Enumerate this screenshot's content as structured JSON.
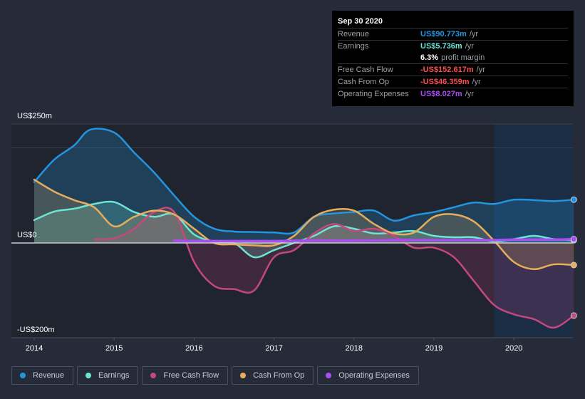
{
  "tooltip": {
    "date": "Sep 30 2020",
    "rows": [
      {
        "label": "Revenue",
        "value": "US$90.773m",
        "unit": "/yr",
        "color": "#2394df"
      },
      {
        "label": "Earnings",
        "value": "US$5.736m",
        "unit": "/yr",
        "color": "#6ce5d4"
      },
      {
        "label": "",
        "value": "6.3%",
        "unit": "profit margin",
        "color": "#ffffff"
      },
      {
        "label": "Free Cash Flow",
        "value": "-US$152.617m",
        "unit": "/yr",
        "color": "#ff4d4d"
      },
      {
        "label": "Cash From Op",
        "value": "-US$46.359m",
        "unit": "/yr",
        "color": "#ff4d4d"
      },
      {
        "label": "Operating Expenses",
        "value": "US$8.027m",
        "unit": "/yr",
        "color": "#a94ef2"
      }
    ]
  },
  "legend": [
    {
      "label": "Revenue",
      "color": "#2394df"
    },
    {
      "label": "Earnings",
      "color": "#6ce5d4"
    },
    {
      "label": "Free Cash Flow",
      "color": "#c4487f"
    },
    {
      "label": "Cash From Op",
      "color": "#e8ad5c"
    },
    {
      "label": "Operating Expenses",
      "color": "#a94ef2"
    }
  ],
  "chart_data": {
    "type": "line",
    "title": "",
    "xlabel": "",
    "ylabel": "",
    "y_tick_labels": [
      "US$250m",
      "US$0",
      "-US$200m"
    ],
    "x_tick_labels": [
      "2014",
      "2015",
      "2016",
      "2017",
      "2018",
      "2019",
      "2020"
    ],
    "xlim": [
      2014,
      2020.75
    ],
    "ylim": [
      -200,
      250
    ],
    "grid": true,
    "forecast_shade_from": 2019.75,
    "series": [
      {
        "name": "Revenue",
        "color": "#2394df",
        "x": [
          2014.0,
          2014.25,
          2014.5,
          2014.7,
          2015.0,
          2015.25,
          2015.5,
          2015.75,
          2016.0,
          2016.25,
          2016.5,
          2016.75,
          2017.0,
          2017.25,
          2017.5,
          2017.75,
          2018.0,
          2018.25,
          2018.5,
          2018.75,
          2019.0,
          2019.25,
          2019.5,
          2019.75,
          2020.0,
          2020.25,
          2020.5,
          2020.75
        ],
        "y": [
          128,
          175,
          205,
          238,
          232,
          190,
          148,
          100,
          55,
          30,
          24,
          23,
          22,
          22,
          55,
          62,
          65,
          68,
          47,
          58,
          65,
          75,
          85,
          82,
          91,
          90,
          88,
          91
        ]
      },
      {
        "name": "Earnings",
        "color": "#6ce5d4",
        "x": [
          2014.0,
          2014.25,
          2014.5,
          2014.75,
          2015.0,
          2015.25,
          2015.5,
          2015.75,
          2016.0,
          2016.25,
          2016.5,
          2016.75,
          2017.0,
          2017.25,
          2017.5,
          2017.75,
          2018.0,
          2018.25,
          2018.5,
          2018.75,
          2019.0,
          2019.25,
          2019.5,
          2019.75,
          2020.0,
          2020.25,
          2020.5,
          2020.75
        ],
        "y": [
          48,
          66,
          72,
          82,
          86,
          65,
          55,
          60,
          18,
          3,
          0,
          -30,
          -15,
          0,
          15,
          35,
          30,
          20,
          22,
          25,
          15,
          12,
          12,
          3,
          8,
          15,
          8,
          5.7
        ]
      },
      {
        "name": "Free Cash Flow",
        "color": "#c4487f",
        "x": [
          2014.75,
          2015.0,
          2015.25,
          2015.5,
          2015.75,
          2016.0,
          2016.25,
          2016.5,
          2016.75,
          2017.0,
          2017.25,
          2017.5,
          2017.75,
          2018.0,
          2018.25,
          2018.5,
          2018.75,
          2019.0,
          2019.25,
          2019.5,
          2019.75,
          2020.0,
          2020.25,
          2020.5,
          2020.75
        ],
        "y": [
          8,
          10,
          30,
          65,
          65,
          -40,
          -90,
          -97,
          -100,
          -30,
          -15,
          20,
          40,
          25,
          30,
          15,
          -10,
          -10,
          -30,
          -80,
          -130,
          -150,
          -160,
          -178,
          -152.6
        ]
      },
      {
        "name": "Cash From Op",
        "color": "#e8ad5c",
        "x": [
          2014.0,
          2014.25,
          2014.5,
          2014.75,
          2015.0,
          2015.25,
          2015.5,
          2015.75,
          2016.0,
          2016.25,
          2016.5,
          2016.75,
          2017.0,
          2017.25,
          2017.5,
          2017.75,
          2018.0,
          2018.25,
          2018.5,
          2018.75,
          2019.0,
          2019.25,
          2019.5,
          2019.75,
          2020.0,
          2020.25,
          2020.5,
          2020.75
        ],
        "y": [
          133,
          108,
          90,
          75,
          35,
          55,
          68,
          60,
          30,
          0,
          -3,
          -5,
          -5,
          15,
          55,
          70,
          68,
          40,
          20,
          22,
          55,
          60,
          45,
          5,
          -40,
          -55,
          -45,
          -46.4
        ]
      },
      {
        "name": "Operating Expenses",
        "color": "#a94ef2",
        "x": [
          2015.75,
          2016.0,
          2016.5,
          2017.0,
          2017.5,
          2018.0,
          2018.5,
          2019.0,
          2019.5,
          2019.75,
          2020.0,
          2020.5,
          2020.75
        ],
        "y": [
          5,
          4,
          4,
          4,
          5,
          5,
          6,
          6,
          6,
          6,
          7,
          7,
          8.0
        ]
      }
    ]
  }
}
